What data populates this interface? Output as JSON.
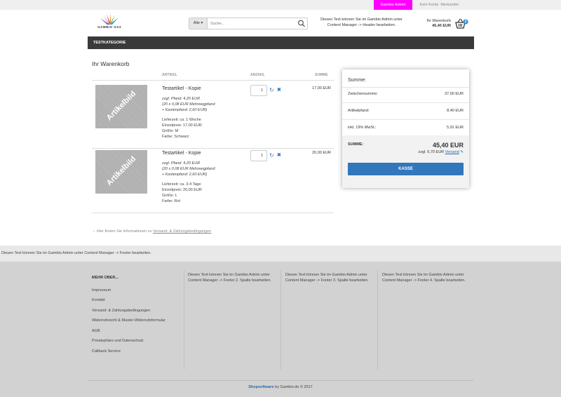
{
  "topbar": {
    "admin_label": "Gambio Admin",
    "no_account": "Kein Konto",
    "wishlist": "Merkzettel"
  },
  "header": {
    "logo_text": "GAMBIO GX3",
    "search_category": "Alle",
    "search_placeholder": "Suche...",
    "header_text": "Diesen Text können Sie im Gambio Admin unter Content Manager -> Header bearbeiten.",
    "cart_label": "Ihr Warenkorb",
    "cart_total": "45,40 EUR",
    "cart_count": "2"
  },
  "nav": {
    "category": "TESTKATEGORIE"
  },
  "cart": {
    "title": "Ihr Warenkorb",
    "columns": {
      "article": "ARTIKEL",
      "quantity": "ANZAHL",
      "sum": "SUMME"
    },
    "items": [
      {
        "image_label": "Artikelbild",
        "name": "Testartikel - Kopie",
        "deposit1": "zzgl. Pfand: 4,20 EUR",
        "deposit2": "(20 x 0,08 EUR Mehrwegpfand",
        "deposit3": "+ Kastenpfand: 2,60 EUR)",
        "delivery": "Lieferzeit: ca. 1 Woche",
        "unit_price": "Einzelpreis: 17,00 EUR",
        "size": "Größe: M",
        "color": "Farbe: Schwarz",
        "qty": "1",
        "price": "17,00 EUR"
      },
      {
        "image_label": "Artikelbild",
        "name": "Testartikel - Kopie",
        "deposit1": "zzgl. Pfand: 4,20 EUR",
        "deposit2": "(20 x 0,08 EUR Mehrwegpfand",
        "deposit3": "+ Kastenpfand: 2,60 EUR)",
        "delivery": "Lieferzeit: ca. 3-4 Tage",
        "unit_price": "Einzelpreis: 20,00 EUR",
        "size": "Größe: L",
        "color": "Farbe: Rot",
        "qty": "1",
        "price": "20,00 EUR"
      }
    ],
    "shipping_info_prefix": "Hier finden Sie Informationen zu",
    "shipping_info_link": "Versand- & Zahlungsbedingungen"
  },
  "summary": {
    "title": "Summe:",
    "subtotal_label": "Zwischensumme:",
    "subtotal_value": "37,00 EUR",
    "deposit_label": "Artikelpfand:",
    "deposit_value": "8,40 EUR",
    "vat_label": "inkl. 19% MwSt.:",
    "vat_value": "5,91 EUR",
    "total_label": "SUMME:",
    "total_value": "45,40 EUR",
    "shipping_prefix": "zzgl. 6,70 EUR",
    "shipping_link": "Versand",
    "checkout": "KASSE"
  },
  "footer": {
    "strip_text": "Diesen Text können Sie im Gambio Admin unter Content Manager -> Footer bearbeiten.",
    "col1_title": "MEHR ÜBER...",
    "links": [
      "Impressum",
      "Kontakt",
      "Versand- & Zahlungsbedingungen",
      "Widerrufsrecht & Muster-Widerrufsformular",
      "AGB",
      "Privatsphäre und Datenschutz",
      "Callback Service"
    ],
    "col2": "Diesen Text können Sie im Gambio Admin unter Content Manager -> Footer 2. Spalte bearbeiten.",
    "col3": "Diesen Text können Sie im Gambio Admin unter Content Manager -> Footer 3. Spalte bearbeiten.",
    "col4": "Diesen Text können Sie im Gambio Admin unter Content Manager -> Footer 4. Spalte bearbeiten.",
    "copyright_link": "Shopsoftware",
    "copyright_rest": " by Gambio.de © 2017"
  },
  "colors": {
    "admin_accent": "#ff00ff",
    "nav_bg": "#3a3a3a",
    "primary_button": "#3276bc",
    "link": "#2b68b3"
  }
}
